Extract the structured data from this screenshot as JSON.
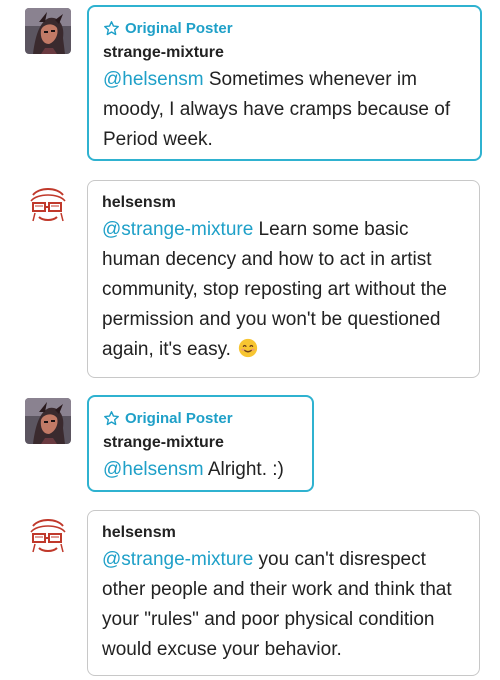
{
  "op_label": "Original Poster",
  "replies": [
    {
      "username": "strange-mixture",
      "is_op": true,
      "mention": "@helsensm",
      "text": " Sometimes whenever im moody, I always have cramps because of Period week.",
      "avatar": "dark-portrait-avatar"
    },
    {
      "username": "helsensm",
      "is_op": false,
      "mention": "@strange-mixture",
      "text": " Learn some basic human decency and how to act in artist community, stop reposting art without the permission and you won't be questioned again, it's easy. ",
      "emoji": "smiling-face-emoji",
      "avatar": "red-sketch-avatar"
    },
    {
      "username": "strange-mixture",
      "is_op": true,
      "mention": "@helsensm",
      "text": " Alright. :)",
      "avatar": "dark-portrait-avatar"
    },
    {
      "username": "helsensm",
      "is_op": false,
      "mention": "@strange-mixture",
      "text": " you can't disrespect other people and their work and think that your \"rules\" and poor physical condition would excuse your behavior.",
      "avatar": "red-sketch-avatar"
    }
  ],
  "colors": {
    "accent": "#1fa0c8",
    "op_border": "#2fb2d0",
    "bubble_border": "#c8c8c8",
    "text": "#222222"
  }
}
